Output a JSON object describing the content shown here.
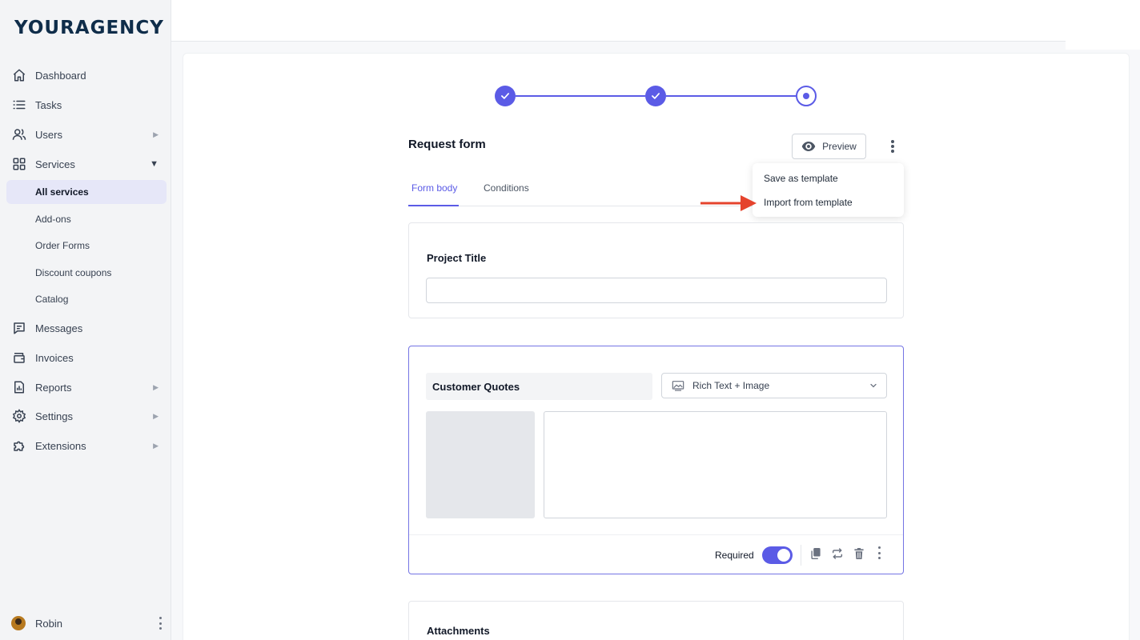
{
  "brand": {
    "logo_text": "YOURAGENCY"
  },
  "sidebar": {
    "items": [
      {
        "label": "Dashboard",
        "icon": "home-icon"
      },
      {
        "label": "Tasks",
        "icon": "list-icon"
      },
      {
        "label": "Users",
        "icon": "users-icon",
        "has_submenu": true
      },
      {
        "label": "Services",
        "icon": "grid-icon",
        "expanded": true
      },
      {
        "label": "Messages",
        "icon": "chat-icon"
      },
      {
        "label": "Invoices",
        "icon": "wallet-icon"
      },
      {
        "label": "Reports",
        "icon": "report-icon",
        "has_submenu": true
      },
      {
        "label": "Settings",
        "icon": "gear-icon",
        "has_submenu": true
      },
      {
        "label": "Extensions",
        "icon": "puzzle-icon",
        "has_submenu": true
      }
    ],
    "services_sub": [
      {
        "label": "All services",
        "active": true
      },
      {
        "label": "Add-ons"
      },
      {
        "label": "Order Forms"
      },
      {
        "label": "Discount coupons"
      },
      {
        "label": "Catalog"
      }
    ],
    "user": {
      "name": "Robin"
    }
  },
  "stepper": {
    "steps_completed": 2,
    "steps_total": 3,
    "current_step": 3
  },
  "form": {
    "title": "Request form",
    "preview_label": "Preview",
    "tabs": [
      {
        "label": "Form body",
        "active": true
      },
      {
        "label": "Conditions"
      }
    ],
    "menu": {
      "items": [
        "Save as template",
        "Import from template"
      ],
      "highlighted": "Import from template"
    },
    "fields": [
      {
        "label": "Project Title",
        "type": "text",
        "value": ""
      },
      {
        "label": "Customer Quotes",
        "type": "Rich Text + Image",
        "required": true
      },
      {
        "label": "Attachments"
      }
    ],
    "required_label": "Required"
  },
  "colors": {
    "accent": "#5b5be6",
    "arrow": "#e5432d",
    "brand": "#0f2d4a"
  }
}
